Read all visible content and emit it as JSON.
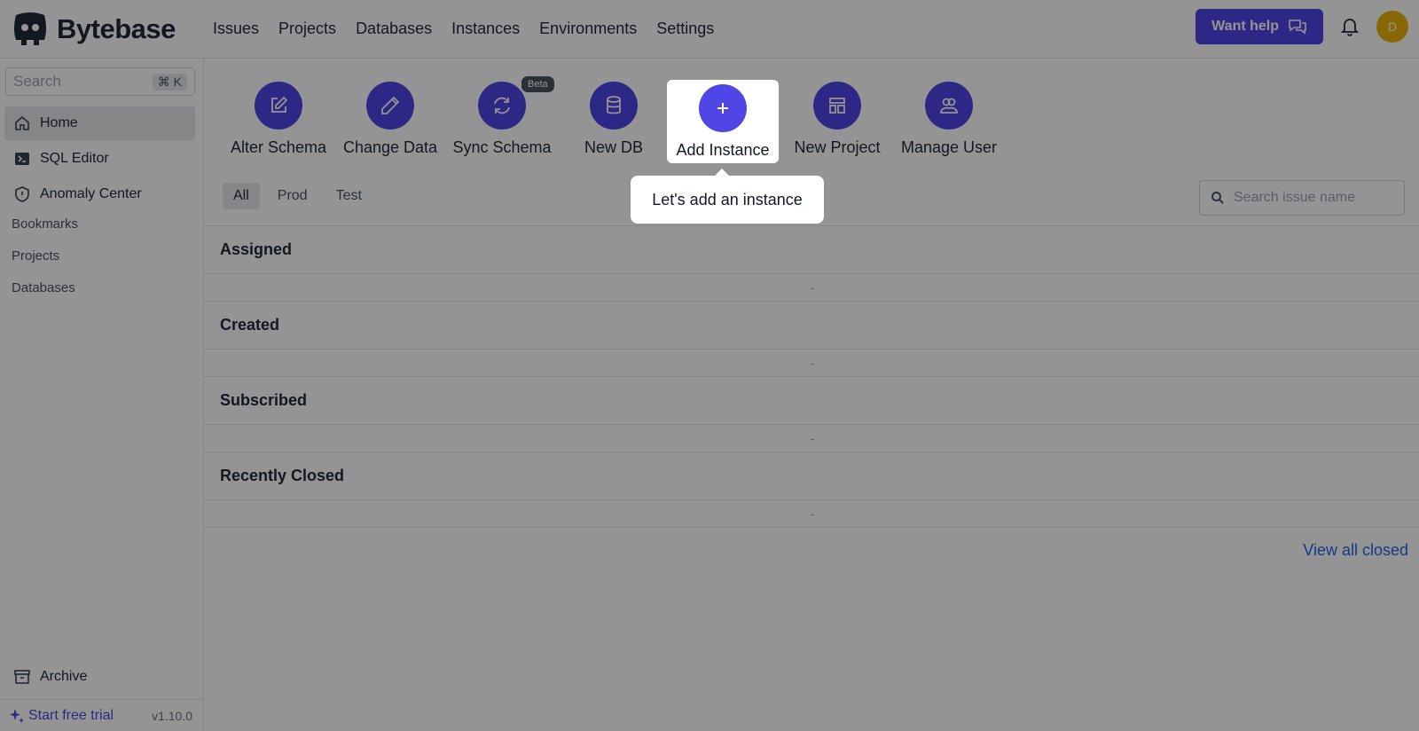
{
  "brand": {
    "name": "Bytebase"
  },
  "nav": [
    "Issues",
    "Projects",
    "Databases",
    "Instances",
    "Environments",
    "Settings"
  ],
  "header": {
    "help_label": "Want help",
    "avatar_initial": "D"
  },
  "sidebar": {
    "search_placeholder": "Search",
    "shortcut": "⌘ K",
    "items": [
      {
        "label": "Home",
        "icon": "home-icon"
      },
      {
        "label": "SQL Editor",
        "icon": "terminal-icon"
      },
      {
        "label": "Anomaly Center",
        "icon": "shield-icon"
      }
    ],
    "links": [
      "Bookmarks",
      "Projects",
      "Databases"
    ],
    "archive_label": "Archive",
    "trial_label": "Start free trial",
    "version": "v1.10.0"
  },
  "quick_actions": [
    {
      "label": "Alter Schema",
      "icon": "edit-icon"
    },
    {
      "label": "Change Data",
      "icon": "pencil-icon"
    },
    {
      "label": "Sync Schema",
      "icon": "refresh-icon",
      "badge": "Beta"
    },
    {
      "label": "New DB",
      "icon": "database-icon"
    },
    {
      "label": "Add Instance",
      "icon": "plus-icon"
    },
    {
      "label": "New Project",
      "icon": "layout-icon"
    },
    {
      "label": "Manage User",
      "icon": "users-icon"
    }
  ],
  "filter_tabs": [
    "All",
    "Prod",
    "Test"
  ],
  "issue_search_placeholder": "Search issue name",
  "sections": [
    {
      "title": "Assigned",
      "empty": "-"
    },
    {
      "title": "Created",
      "empty": "-"
    },
    {
      "title": "Subscribed",
      "empty": "-"
    },
    {
      "title": "Recently Closed",
      "empty": "-"
    }
  ],
  "view_all_closed": "View all closed",
  "tooltip": "Let's add an instance",
  "colors": {
    "accent": "#4f46e5",
    "avatar": "#eab308",
    "link": "#2563eb"
  }
}
